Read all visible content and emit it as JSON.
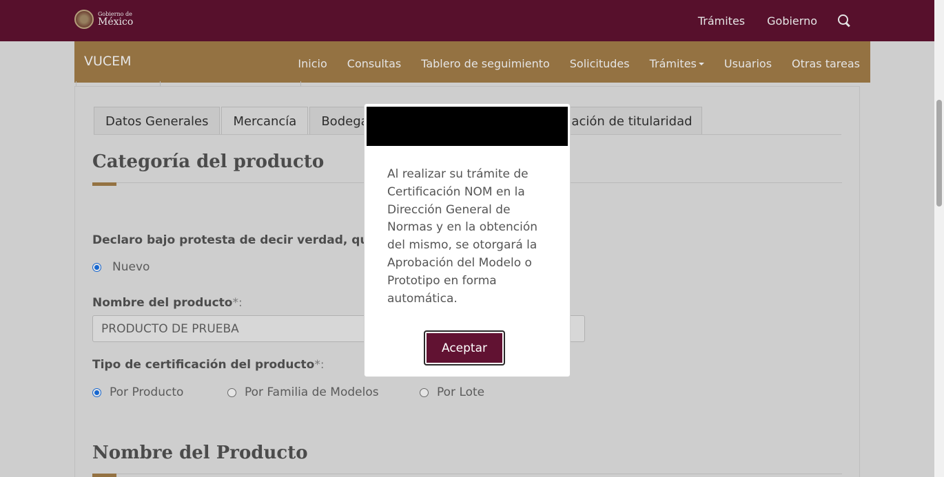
{
  "gov": {
    "logo_small": "Gobierno de",
    "logo_big": "México",
    "nav": [
      "Trámites",
      "Gobierno"
    ]
  },
  "vucem": {
    "brand": "VUCEM",
    "nav": [
      "Inicio",
      "Consultas",
      "Tablero de seguimiento",
      "Solicitudes",
      "Trámites",
      "Usuarios",
      "Otras tareas"
    ]
  },
  "tabs": [
    "Datos Generales",
    "Mercancía",
    "Bodegas"
  ],
  "tab_partial": "pliación de titularidad",
  "section1": {
    "title": "Categoría del producto",
    "declaro": "Declaro bajo protesta de decir verdad, que e",
    "radio_nuevo": "Nuevo"
  },
  "nombre_producto": {
    "label": "Nombre del producto",
    "required": "*:",
    "value": "PRODUCTO DE PRUEBA"
  },
  "tipo_cert": {
    "label": "Tipo de certificación del producto",
    "required": "*:",
    "options": [
      "Por Producto",
      "Por Familia de Modelos",
      "Por Lote"
    ]
  },
  "section2": {
    "title": "Nombre del Producto"
  },
  "modal": {
    "body": "Al realizar su trámite de Certificación NOM en la Dirección General de Normas y en la obtención del mismo, se otorgará la Aprobación del Modelo o Prototipo en forma automática.",
    "accept_label": "Aceptar"
  },
  "colors": {
    "gov_bar": "#611232",
    "vucem_bar": "#a57f4a",
    "radio_selected": "#1a73e8"
  }
}
